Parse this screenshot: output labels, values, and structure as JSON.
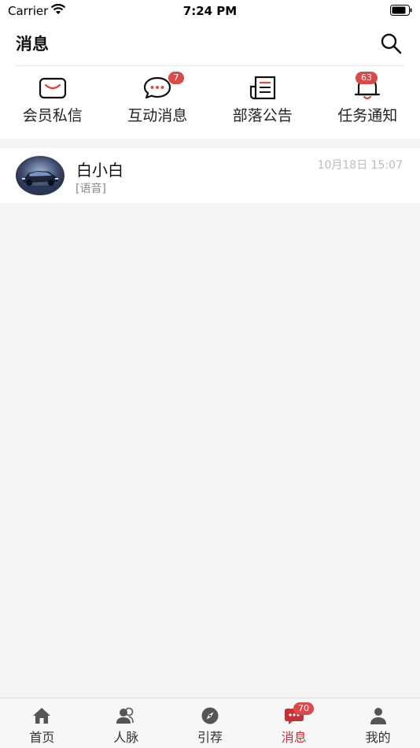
{
  "status_bar": {
    "carrier": "Carrier",
    "time": "7:24 PM"
  },
  "header": {
    "title": "消息"
  },
  "quick_actions": [
    {
      "label": "会员私信",
      "icon": "mail-icon"
    },
    {
      "label": "互动消息",
      "icon": "chat-bubble-icon",
      "badge": "7"
    },
    {
      "label": "部落公告",
      "icon": "document-icon"
    },
    {
      "label": "任务通知",
      "icon": "bell-icon",
      "badge": "63"
    }
  ],
  "messages": [
    {
      "name": "白小白",
      "preview": "[语音]",
      "time": "10月18日 15:07"
    }
  ],
  "tabs": [
    {
      "label": "首页",
      "icon": "home-icon"
    },
    {
      "label": "人脉",
      "icon": "contacts-icon"
    },
    {
      "label": "引荐",
      "icon": "compass-icon"
    },
    {
      "label": "消息",
      "icon": "message-icon",
      "badge": "70",
      "active": true
    },
    {
      "label": "我的",
      "icon": "profile-icon"
    }
  ],
  "colors": {
    "accent": "#c2323a",
    "badge": "#d94a4a"
  }
}
